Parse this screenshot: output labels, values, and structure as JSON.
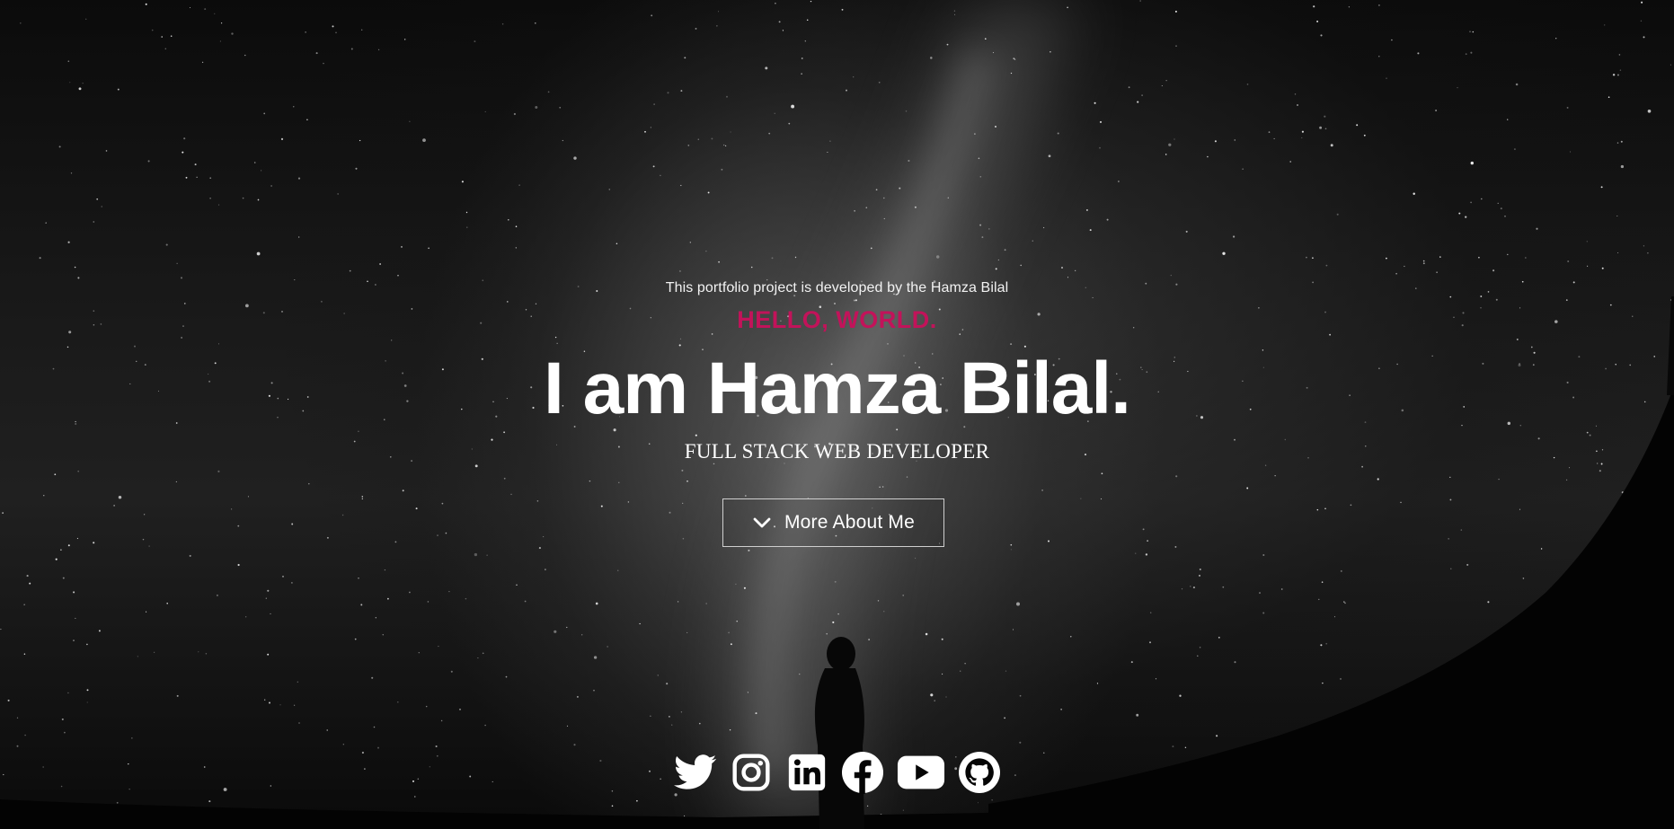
{
  "hero": {
    "credit": "This portfolio project is developed by the Hamza Bilal",
    "greeting": "HELLO, WORLD.",
    "headline": "I am Hamza Bilal.",
    "role": "FULL STACK WEB DEVELOPER",
    "cta_label": "More About Me",
    "cta_icon": "chevron-down-icon"
  },
  "colors": {
    "accent": "#c2135a",
    "text": "#ffffff",
    "background": "#050505"
  },
  "socials": [
    {
      "icon": "twitter-icon"
    },
    {
      "icon": "instagram-icon"
    },
    {
      "icon": "linkedin-icon"
    },
    {
      "icon": "facebook-icon"
    },
    {
      "icon": "youtube-icon"
    },
    {
      "icon": "github-icon"
    }
  ]
}
